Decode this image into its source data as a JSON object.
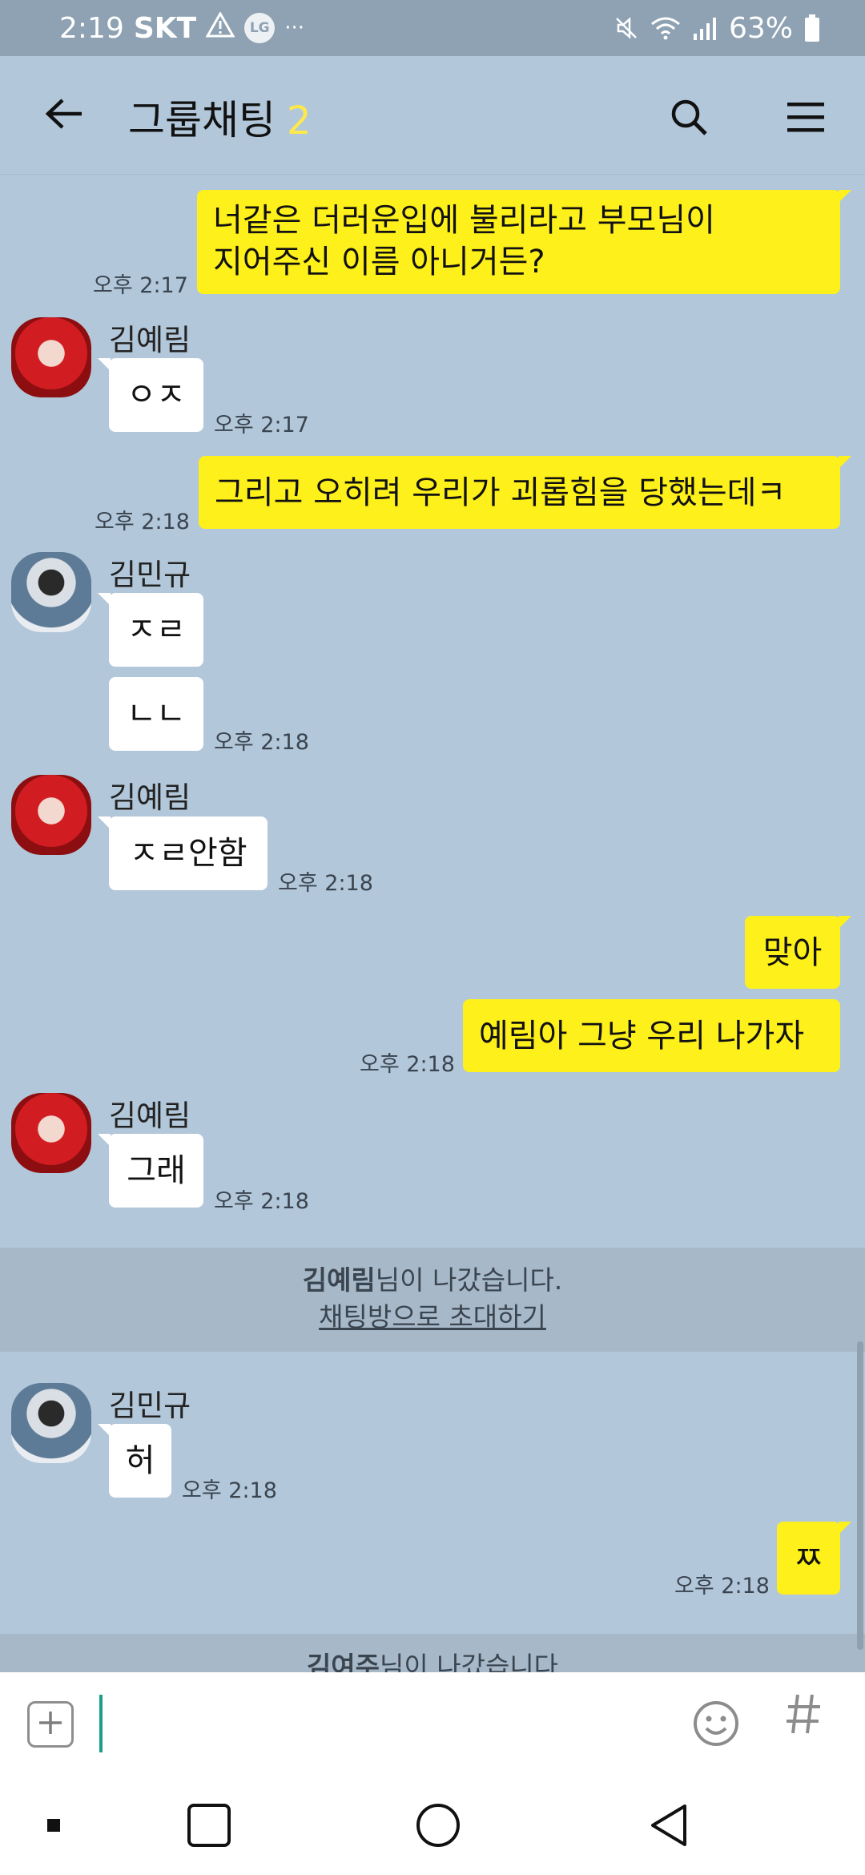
{
  "status_bar": {
    "time": "2:19",
    "carrier": "SKT",
    "lg": "LG",
    "more": "···",
    "battery": "63%"
  },
  "header": {
    "title": "그룹채팅",
    "member_count": "2"
  },
  "messages": {
    "m1": {
      "line1": "너같은 더러운입에 불리라고 부모님이",
      "line2": "지어주신 이름 아니거든?",
      "time": "오후 2:17"
    },
    "m2": {
      "sender": "김예림",
      "text": "ㅇㅈ",
      "time": "오후 2:17"
    },
    "m3": {
      "text": "그리고 오히려 우리가 괴롭힘을 당했는데ㅋ",
      "time": "오후 2:18"
    },
    "m4": {
      "sender": "김민규",
      "text1": "ㅈㄹ",
      "text2": "ㄴㄴ",
      "time": "오후 2:18"
    },
    "m5": {
      "sender": "김예림",
      "text": "ㅈㄹ안함",
      "time": "오후 2:18"
    },
    "m6": {
      "text1": "맞아",
      "text2": "예림아 그냥 우리 나가자",
      "time": "오후 2:18"
    },
    "m7": {
      "sender": "김예림",
      "text": "그래",
      "time": "오후 2:18"
    },
    "notice1": {
      "name": "김예림",
      "suffix": "님이 나갔습니다.",
      "invite": "채팅방으로 초대하기"
    },
    "m8": {
      "sender": "김민규",
      "text": "허",
      "time": "오후 2:18"
    },
    "m9": {
      "text": "ㅉ",
      "time": "오후 2:18"
    },
    "notice2": {
      "name": "김여주",
      "suffix": "님이 나갔습니다"
    }
  },
  "input": {
    "placeholder": ""
  },
  "icons": {
    "back": "arrow-left-icon",
    "search": "search-icon",
    "menu": "hamburger-menu-icon",
    "attach": "plus-box-icon",
    "emoji": "smiley-icon",
    "hash": "hash-icon"
  },
  "colors": {
    "chat_bg": "#b2c7d9",
    "my_bubble": "#fef01b",
    "their_bubble": "#ffffff",
    "member_count": "#ffe94a"
  }
}
